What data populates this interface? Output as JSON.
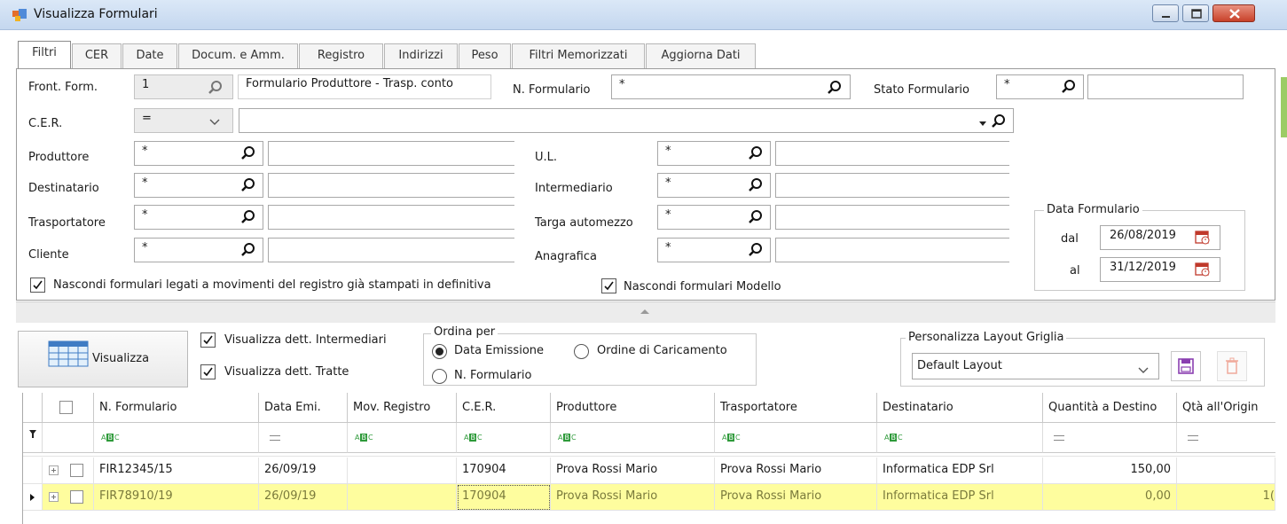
{
  "window": {
    "title": "Visualizza Formulari"
  },
  "tabs": [
    {
      "label": "Filtri"
    },
    {
      "label": "CER"
    },
    {
      "label": "Date"
    },
    {
      "label": "Docum. e Amm."
    },
    {
      "label": "Registro"
    },
    {
      "label": "Indirizzi"
    },
    {
      "label": "Peso"
    },
    {
      "label": "Filtri Memorizzati"
    },
    {
      "label": "Aggiorna Dati"
    }
  ],
  "filters": {
    "front_form": {
      "label": "Front. Form.",
      "value": "1",
      "desc": "Formulario Produttore - Trasp. conto"
    },
    "n_formulario": {
      "label": "N. Formulario",
      "value": "*"
    },
    "stato_formulario": {
      "label": "Stato Formulario",
      "value": "*"
    },
    "cer": {
      "label": "C.E.R.",
      "operator": "="
    },
    "produttore": {
      "label": "Produttore",
      "value": "*"
    },
    "destinatario": {
      "label": "Destinatario",
      "value": "*"
    },
    "trasportatore": {
      "label": "Trasportatore",
      "value": "*"
    },
    "cliente": {
      "label": "Cliente",
      "value": "*"
    },
    "ul": {
      "label": "U.L.",
      "value": "*"
    },
    "intermediario": {
      "label": "Intermediario",
      "value": "*"
    },
    "targa": {
      "label": "Targa automezzo",
      "value": "*"
    },
    "anagrafica": {
      "label": "Anagrafica",
      "value": "*"
    },
    "data_formulario": {
      "title": "Data Formulario",
      "dal_label": "dal",
      "dal": "26/08/2019",
      "al_label": "al",
      "al": "31/12/2019"
    },
    "hide_printed": {
      "label": "Nascondi formulari legati a movimenti del registro già stampati in definitiva",
      "checked": true
    },
    "hide_model": {
      "label": "Nascondi formulari Modello",
      "checked": true
    }
  },
  "toolbar": {
    "visualizza_label": "Visualizza",
    "dett_intermediari": {
      "label": "Visualizza dett. Intermediari",
      "checked": true
    },
    "dett_tratte": {
      "label": "Visualizza dett. Tratte",
      "checked": true
    },
    "ordina": {
      "title": "Ordina per",
      "options": [
        {
          "label": "Data Emissione",
          "selected": true
        },
        {
          "label": "Ordine di Caricamento",
          "selected": false
        },
        {
          "label": "N. Formulario",
          "selected": false
        }
      ]
    },
    "layout": {
      "title": "Personalizza Layout Griglia",
      "selected": "Default Layout"
    }
  },
  "grid": {
    "columns": [
      "N. Formulario",
      "Data Emi.",
      "Mov. Registro",
      "C.E.R.",
      "Produttore",
      "Trasportatore",
      "Destinatario",
      "Quantità a Destino",
      "Qtà all'Origin"
    ],
    "filter_abc": [
      "A",
      "B",
      "C"
    ],
    "rows": [
      {
        "n_formulario": "FIR12345/15",
        "data_emi": "26/09/19",
        "mov_registro": "",
        "cer": "170904",
        "produttore": "Prova Rossi Mario",
        "trasportatore": "Prova Rossi Mario",
        "destinatario": "Informatica EDP Srl",
        "qta_destino": "150,00",
        "qta_origine": ""
      },
      {
        "n_formulario": "FIR78910/19",
        "data_emi": "26/09/19",
        "mov_registro": "",
        "cer": "170904",
        "produttore": "Prova Rossi Mario",
        "trasportatore": "Prova Rossi Mario",
        "destinatario": "Informatica EDP Srl",
        "qta_destino": "0,00",
        "qta_origine": "1("
      }
    ]
  },
  "colors": {
    "selected_row": "#fefd9e",
    "accent_purple": "#8a3fb0",
    "title_bar": "#c4d7ef"
  }
}
